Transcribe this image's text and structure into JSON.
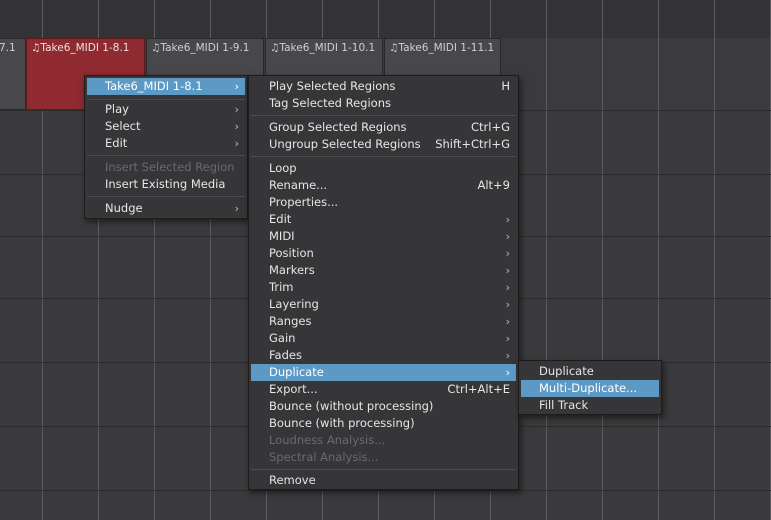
{
  "regions": [
    {
      "label": "7.1",
      "selected": false
    },
    {
      "label": "♫Take6_MIDI 1-8.1",
      "selected": true
    },
    {
      "label": "♫Take6_MIDI 1-9.1",
      "selected": false
    },
    {
      "label": "♫Take6_MIDI 1-10.1",
      "selected": false
    },
    {
      "label": "♫Take6_MIDI 1-11.1",
      "selected": false
    }
  ],
  "context_menu": {
    "items": [
      {
        "label": "Take6_MIDI 1-8.1",
        "submenu": true,
        "highlighted": true
      },
      {
        "label": "Play",
        "submenu": true
      },
      {
        "label": "Select",
        "submenu": true
      },
      {
        "label": "Edit",
        "submenu": true
      },
      {
        "label": "Insert Selected Region",
        "disabled": true
      },
      {
        "label": "Insert Existing Media"
      },
      {
        "label": "Nudge",
        "submenu": true
      }
    ]
  },
  "region_menu": {
    "items": [
      {
        "label": "Play Selected Regions",
        "shortcut": "H"
      },
      {
        "label": "Tag Selected Regions"
      },
      {
        "label": "Group Selected Regions",
        "shortcut": "Ctrl+G"
      },
      {
        "label": "Ungroup Selected Regions",
        "shortcut": "Shift+Ctrl+G"
      },
      {
        "label": "Loop"
      },
      {
        "label": "Rename...",
        "shortcut": "Alt+9"
      },
      {
        "label": "Properties..."
      },
      {
        "label": "Edit",
        "submenu": true
      },
      {
        "label": "MIDI",
        "submenu": true
      },
      {
        "label": "Position",
        "submenu": true
      },
      {
        "label": "Markers",
        "submenu": true
      },
      {
        "label": "Trim",
        "submenu": true
      },
      {
        "label": "Layering",
        "submenu": true
      },
      {
        "label": "Ranges",
        "submenu": true
      },
      {
        "label": "Gain",
        "submenu": true
      },
      {
        "label": "Fades",
        "submenu": true
      },
      {
        "label": "Duplicate",
        "submenu": true,
        "highlighted": true
      },
      {
        "label": "Export...",
        "shortcut": "Ctrl+Alt+E"
      },
      {
        "label": "Bounce (without processing)"
      },
      {
        "label": "Bounce (with processing)"
      },
      {
        "label": "Loudness Analysis...",
        "disabled": true
      },
      {
        "label": "Spectral Analysis...",
        "disabled": true
      },
      {
        "label": "Remove"
      }
    ]
  },
  "duplicate_menu": {
    "items": [
      {
        "label": "Duplicate"
      },
      {
        "label": "Multi-Duplicate...",
        "highlighted": true
      },
      {
        "label": "Fill Track"
      }
    ]
  },
  "colors": {
    "highlight": "#5c9ac5",
    "selected_region": "#8e2a30"
  }
}
